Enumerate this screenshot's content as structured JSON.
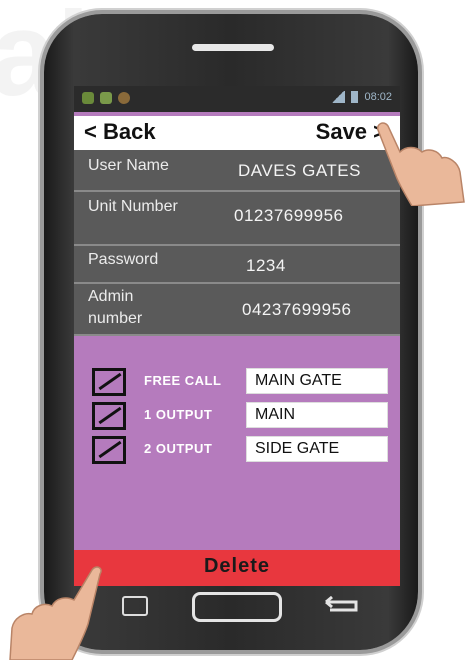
{
  "status_bar": {
    "time": "08:02"
  },
  "header": {
    "back_label": "< Back",
    "save_label": "Save >"
  },
  "fields": [
    {
      "label": "User Name",
      "value": "DAVES GATES"
    },
    {
      "label": "Unit Number",
      "value": "01237699956"
    },
    {
      "label": "Password",
      "value": "1234"
    },
    {
      "label": "Admin number",
      "value": "04237699956"
    }
  ],
  "options": [
    {
      "label": "FREE CALL",
      "value": "MAIN GATE",
      "checked": true
    },
    {
      "label": "1 OUTPUT",
      "value": "MAIN",
      "checked": true
    },
    {
      "label": "2 OUTPUT",
      "value": "SIDE GATE",
      "checked": true
    }
  ],
  "footer": {
    "delete_label": "Delete"
  },
  "colors": {
    "screen_bg": "#b57bbd",
    "field_bg": "#5a5a5a",
    "delete_bg": "#e8373e"
  },
  "icons": [
    "recent-apps-icon",
    "home-icon",
    "back-icon",
    "pointing-hand-icon"
  ]
}
